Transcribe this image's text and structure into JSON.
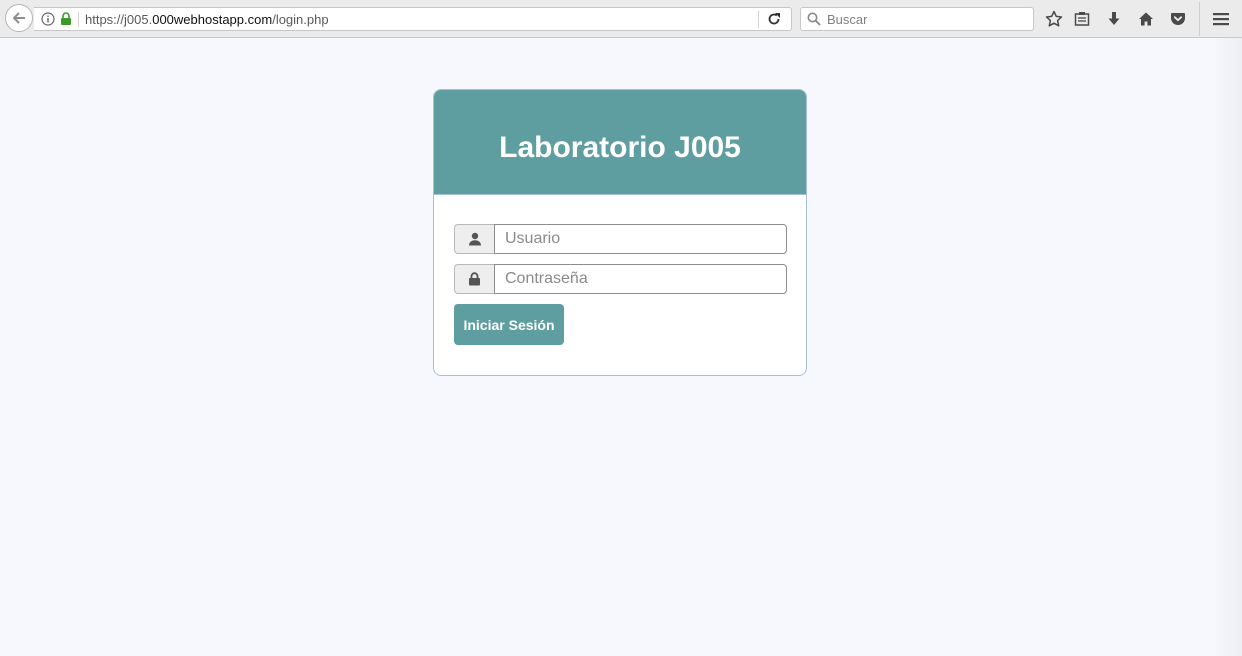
{
  "browser": {
    "url_prefix": "https://j005.",
    "url_host": "000webhostapp.com",
    "url_path": "/login.php",
    "search_placeholder": "Buscar",
    "icons": [
      "back-arrow-icon",
      "info-icon",
      "lock-icon",
      "reload-icon",
      "search-icon",
      "star-icon",
      "reading-list-icon",
      "download-icon",
      "home-icon",
      "pocket-icon",
      "menu-icon"
    ]
  },
  "login": {
    "title": "Laboratorio J005",
    "username_placeholder": "Usuario",
    "password_placeholder": "Contraseña",
    "submit_label": "Iniciar Sesión",
    "icons": [
      "user-icon",
      "lock-icon"
    ]
  },
  "colors": {
    "accent": "#5f9ea0",
    "page_background": "#f7f8fd",
    "card_border": "#a8c0d6"
  }
}
